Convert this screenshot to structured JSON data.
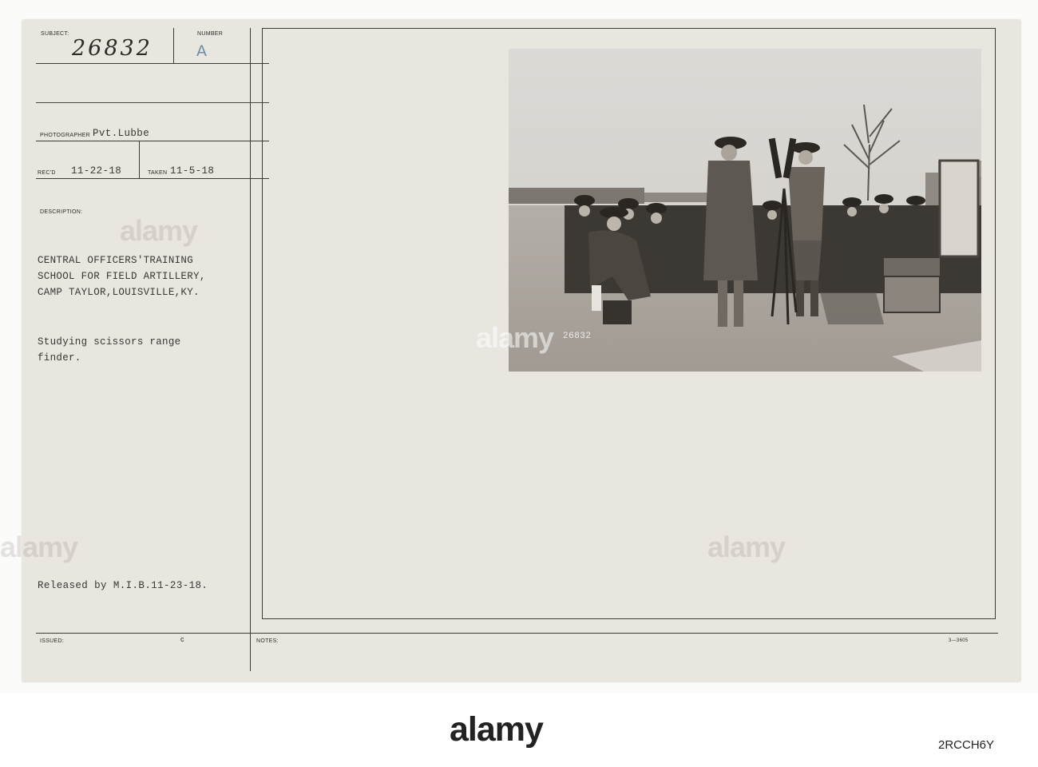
{
  "card": {
    "subject_label": "SUBJECT:",
    "subject_value": "26832",
    "number_label": "NUMBER",
    "number_value": "A",
    "photographer_label": "PHOTOGRAPHER",
    "photographer_value": "Pvt.Lubbe",
    "recd_label": "REC'D",
    "recd_value": "11-22-18",
    "taken_label": "TAKEN",
    "taken_value": "11-5-18",
    "description_label": "DESCRIPTION:",
    "description_lines": [
      "CENTRAL OFFICERS'TRAINING",
      "SCHOOL FOR FIELD ARTILLERY,",
      "CAMP TAYLOR,LOUISVILLE,KY."
    ],
    "caption_lines": [
      "Studying scissors range",
      "finder."
    ],
    "released": "Released by M.I.B.11-23-18.",
    "issued_label": "ISSUED:",
    "issued_mark": "c",
    "notes_label": "NOTES:",
    "form_number": "3—3605",
    "photo_number": "26832"
  },
  "watermark": {
    "text": "alamy"
  },
  "footer": {
    "logo_text": "alamy",
    "image_id": "2RCCH6Y"
  }
}
